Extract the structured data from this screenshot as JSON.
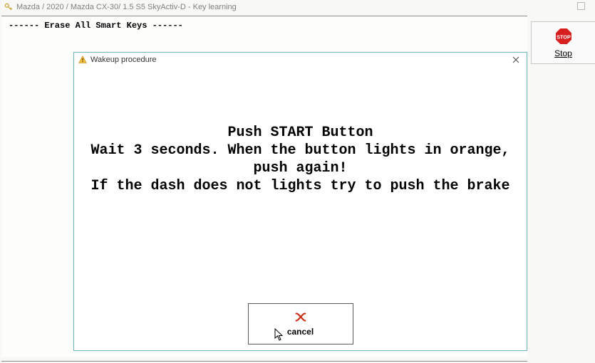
{
  "window": {
    "title": "Mazda / 2020 / Mazda CX-30/ 1.5 S5 SkyActiv-D - Key learning"
  },
  "content": {
    "erase_line": "------ Erase All Smart Keys ------"
  },
  "side": {
    "stop_label": "Stop",
    "stop_text": "STOP"
  },
  "dialog": {
    "title": "Wakeup procedure",
    "instructions": "Push START Button\nWait 3 seconds. When the button lights in orange, push again!\nIf the dash does not lights try to push the brake",
    "cancel_label": "cancel"
  }
}
